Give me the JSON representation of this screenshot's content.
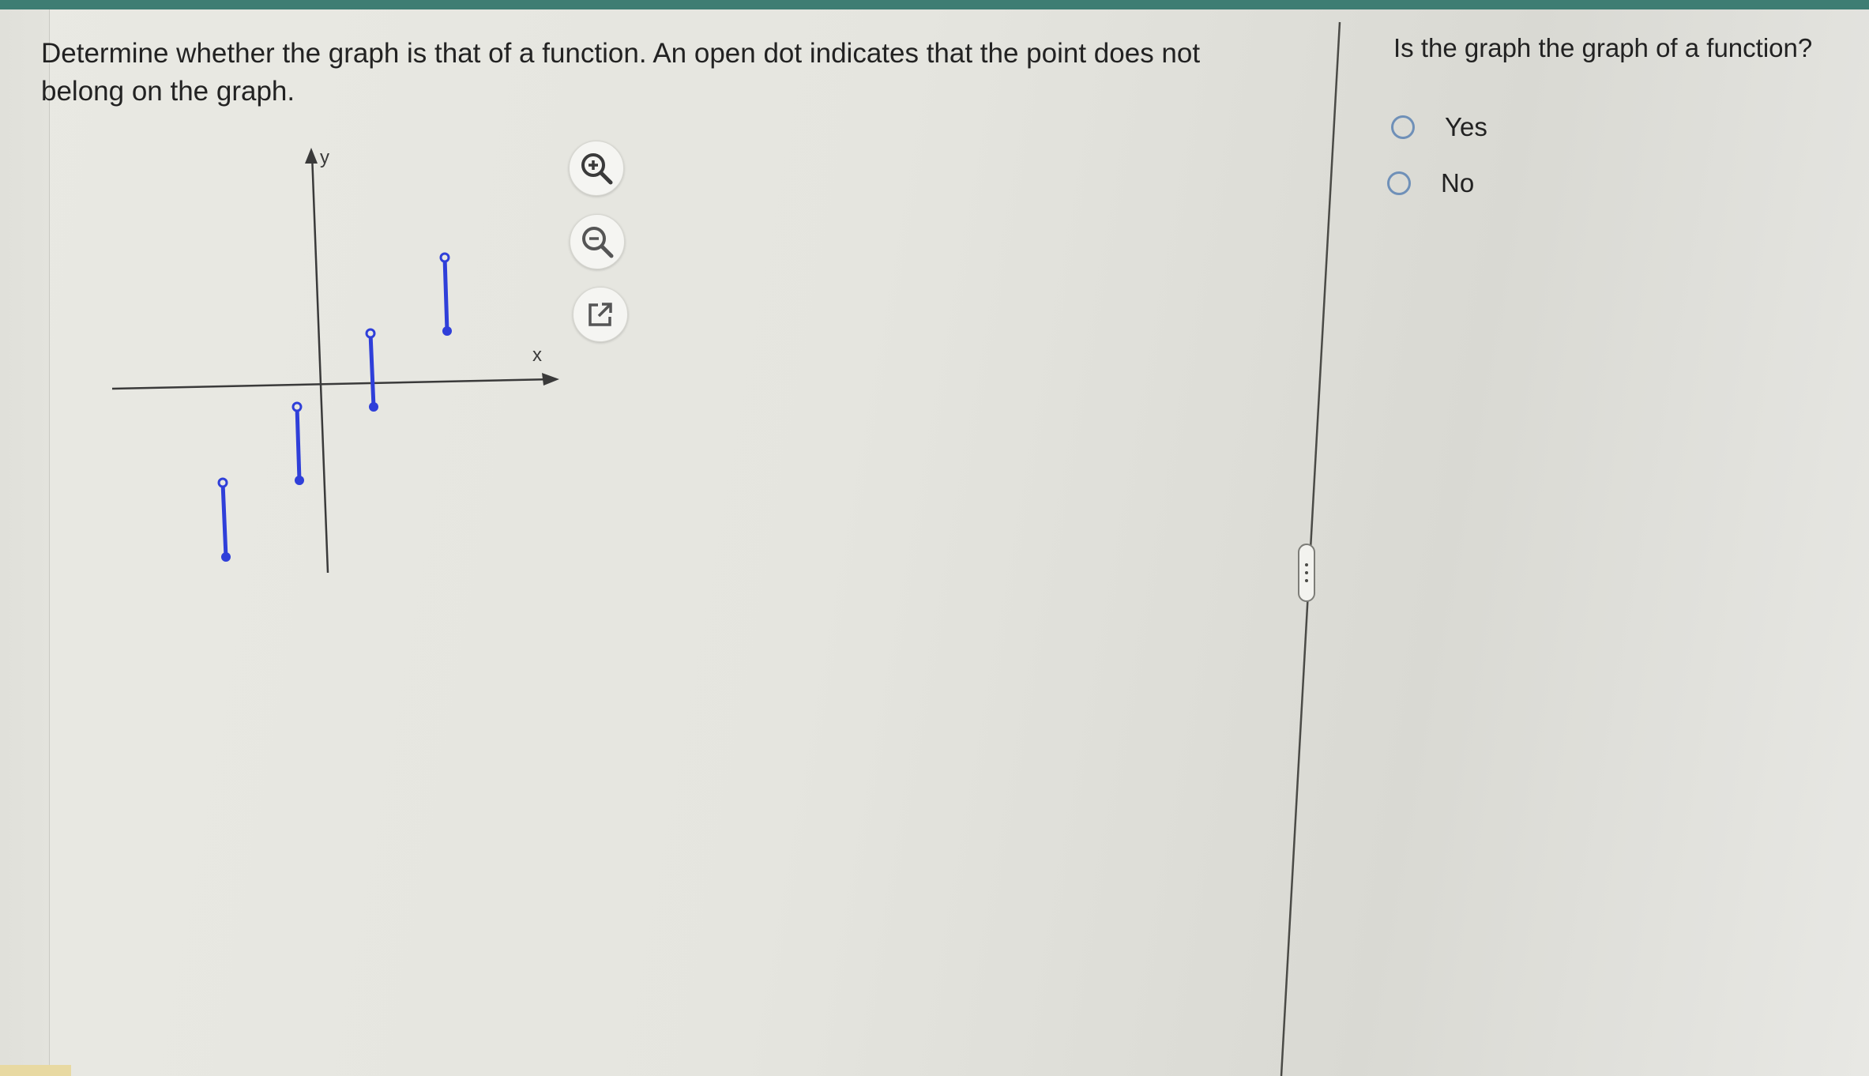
{
  "prompt": {
    "text": "Determine whether the graph is that of a function. An open dot indicates that the point does not belong on the graph."
  },
  "graph": {
    "x_axis_label": "x",
    "y_axis_label": "y",
    "segment_color": "#2f3fd9",
    "axis_color": "#3a3a3a"
  },
  "tools": {
    "zoom_in_icon": "zoom-in-icon",
    "zoom_out_icon": "zoom-out-icon",
    "popout_icon": "external-link-icon"
  },
  "answer": {
    "question": "Is the graph the graph of a function?",
    "options": [
      {
        "label": "Yes",
        "selected": false
      },
      {
        "label": "No",
        "selected": false
      }
    ],
    "radio_color": "#6f90b8"
  },
  "colors": {
    "top_bar": "#3e7d73",
    "background": "#e6e6e0"
  }
}
